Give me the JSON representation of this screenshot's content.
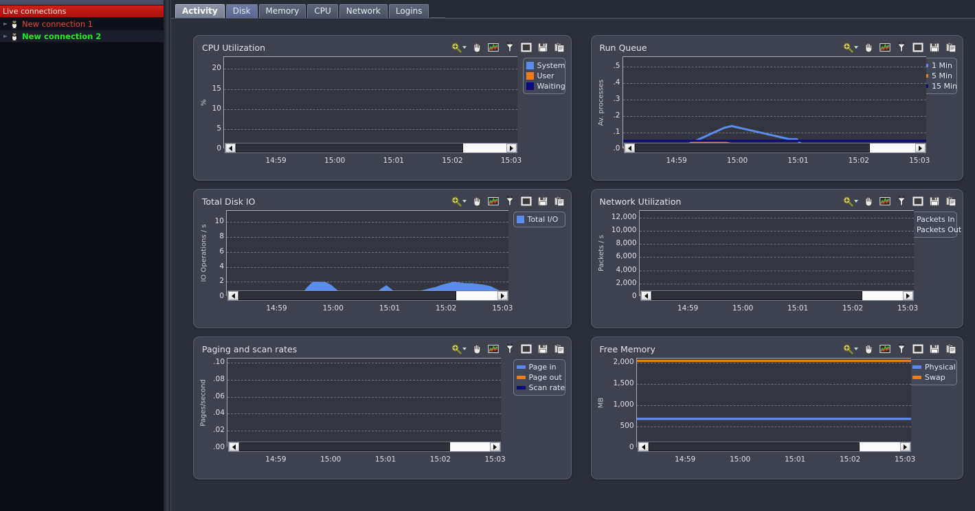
{
  "sidebar": {
    "header": "Live connections",
    "connections": [
      {
        "label": "New connection 1",
        "color": "#e8453c",
        "state": "normal"
      },
      {
        "label": "New connection 2",
        "color": "#22ee22",
        "state": "selected"
      }
    ]
  },
  "tabs": [
    {
      "label": "Activity",
      "active": true
    },
    {
      "label": "Disk",
      "active": false,
      "highlight": true
    },
    {
      "label": "Memory",
      "active": false
    },
    {
      "label": "CPU",
      "active": false
    },
    {
      "label": "Network",
      "active": false
    },
    {
      "label": "Logins",
      "active": false
    }
  ],
  "toolbar": {
    "zoom": "zoom-icon",
    "zoom_caret": "chevron-down-icon",
    "pan": "hand-icon",
    "graph": "line-chart-icon",
    "filter": "funnel-icon",
    "window": "window-icon",
    "save": "floppy-disk-icon",
    "copy": "clipboard-icon"
  },
  "colors": {
    "blue": "#4a82e8",
    "light_blue": "#5b8def",
    "orange": "#f07c18",
    "navy": "#0a0a7a",
    "plot_bg": "#33363f",
    "panel_bg": "#3d424e",
    "accent_red": "#c21a12",
    "accent_green": "#22ee22"
  },
  "chart_data": [
    {
      "id": "cpu-utilization",
      "type": "area",
      "title": "CPU Utilization",
      "ylabel": "%",
      "xlabel": "",
      "ylim": [
        0,
        23
      ],
      "yticks": [
        0,
        5,
        10,
        15,
        20
      ],
      "ytick_labels": [
        "0",
        "5",
        "10",
        "15",
        "20"
      ],
      "xticks": [
        "14:59",
        "15:00",
        "15:01",
        "15:02",
        "15:03"
      ],
      "grid": true,
      "legend_position": "right",
      "legend_style": "box",
      "series": [
        {
          "name": "System",
          "color": "#5b8def",
          "values": [
            0.2,
            0.3,
            0.6,
            1.0,
            1.2,
            0.9,
            0.5,
            0.3,
            0.2,
            0.3,
            0.7,
            1.2,
            0.9,
            0.5,
            0.3,
            0.3,
            0.6,
            1.0,
            1.0,
            1.0,
            1.0,
            1.0,
            1.0,
            1.0,
            1.0,
            1.0,
            1.0,
            1.0,
            1.0,
            1.0,
            1.1,
            1.0,
            1.0,
            1.0,
            1.0,
            1.1,
            1.0,
            0.9,
            0.6,
            0.4,
            0.3,
            0.25,
            0.2
          ]
        },
        {
          "name": "User",
          "color": "#f07c18",
          "values": [
            0,
            0,
            0,
            0,
            0,
            0,
            0,
            0,
            0,
            0,
            0,
            0,
            0,
            0,
            0,
            0,
            0,
            0,
            0,
            0,
            0,
            0,
            0,
            0.3,
            0.8,
            0.9,
            0.6,
            0.3,
            0,
            0,
            0,
            0,
            0,
            0,
            0,
            0,
            0,
            0,
            0,
            0,
            0,
            0,
            0
          ]
        },
        {
          "name": "Waiting",
          "color": "#0a0a7a",
          "values": [
            0,
            0,
            0,
            0,
            0,
            0,
            0,
            0,
            0,
            0,
            0,
            0,
            0,
            0,
            0,
            0,
            0,
            0,
            0,
            0,
            0,
            0,
            0,
            0,
            0,
            0,
            0,
            0,
            0,
            0,
            0,
            0,
            0,
            0,
            0,
            0,
            0,
            0,
            0,
            0,
            0,
            0,
            0
          ]
        }
      ]
    },
    {
      "id": "run-queue",
      "type": "line",
      "title": "Run Queue",
      "ylabel": "Av. processes",
      "xlabel": "",
      "ylim": [
        0,
        0.56
      ],
      "yticks": [
        0.0,
        0.1,
        0.2,
        0.3,
        0.4,
        0.5
      ],
      "ytick_labels": [
        ".0",
        ".1",
        ".2",
        ".3",
        ".4",
        ".5"
      ],
      "xticks": [
        "14:59",
        "15:00",
        "15:01",
        "15:02",
        "15:03"
      ],
      "grid": true,
      "legend_position": "right",
      "legend_style": "line",
      "series": [
        {
          "name": "1 Min",
          "color": "#5b8def",
          "values": [
            0.0,
            0.0,
            0.0,
            0.0,
            0.0,
            0.0,
            0.0,
            0.0,
            0.01,
            0.03,
            0.05,
            0.07,
            0.09,
            0.11,
            0.13,
            0.14,
            0.13,
            0.12,
            0.11,
            0.1,
            0.09,
            0.08,
            0.07,
            0.06,
            0.06,
            0.01,
            0.01,
            0.01,
            0.01,
            0.01,
            0.01,
            0.01,
            0.02,
            0.02,
            0.01,
            0.01,
            0.01,
            0.01,
            0.01,
            0.01,
            0.01,
            0.01,
            0.01
          ]
        },
        {
          "name": "5 Min",
          "color": "#f07c18",
          "values": [
            0.01,
            0.01,
            0.01,
            0.01,
            0.01,
            0.01,
            0.01,
            0.01,
            0.02,
            0.03,
            0.04,
            0.04,
            0.04,
            0.04,
            0.04,
            0.03,
            0.03,
            0.03,
            0.03,
            0.03,
            0.03,
            0.03,
            0.03,
            0.03,
            0.03,
            0.03,
            0.03,
            0.03,
            0.02,
            0.02,
            0.02,
            0.02,
            0.03,
            0.03,
            0.03,
            0.03,
            0.03,
            0.03,
            0.03,
            0.02,
            0.02,
            0.02,
            0.02
          ]
        },
        {
          "name": "15 Min",
          "color": "#0a0a7a",
          "values": [
            0.05,
            0.05,
            0.05,
            0.05,
            0.05,
            0.05,
            0.05,
            0.05,
            0.05,
            0.05,
            0.05,
            0.05,
            0.05,
            0.05,
            0.05,
            0.05,
            0.05,
            0.05,
            0.05,
            0.05,
            0.05,
            0.05,
            0.05,
            0.05,
            0.05,
            0.05,
            0.05,
            0.05,
            0.05,
            0.05,
            0.05,
            0.05,
            0.05,
            0.05,
            0.05,
            0.05,
            0.05,
            0.05,
            0.05,
            0.05,
            0.05,
            0.05,
            0.05
          ]
        }
      ]
    },
    {
      "id": "total-disk-io",
      "type": "area",
      "title": "Total Disk IO",
      "ylabel": "IO Operations / s",
      "xlabel": "",
      "ylim": [
        0,
        11.5
      ],
      "yticks": [
        0,
        2,
        4,
        6,
        8,
        10
      ],
      "ytick_labels": [
        "0",
        "2",
        "4",
        "6",
        "8",
        "10"
      ],
      "xticks": [
        "14:59",
        "15:00",
        "15:01",
        "15:02",
        "15:03"
      ],
      "grid": true,
      "legend_position": "right",
      "legend_style": "box",
      "series": [
        {
          "name": "Total I/O",
          "color": "#5b8def",
          "values": [
            0.1,
            0.1,
            0.2,
            0.25,
            0.3,
            0.25,
            0.1,
            0.1,
            0.2,
            0.35,
            0.3,
            0.15,
            0.1,
            1.2,
            2.0,
            2.0,
            2.0,
            1.6,
            0.9,
            0.25,
            0.4,
            0.8,
            0.5,
            0.2,
            0.3,
            1.0,
            1.55,
            0.9,
            0.2,
            0.3,
            0.5,
            0.7,
            0.9,
            1.1,
            1.3,
            1.6,
            1.8,
            2.0,
            1.9,
            1.8,
            1.8,
            1.7,
            1.6,
            1.4,
            1.0,
            0.6,
            0.4
          ]
        }
      ]
    },
    {
      "id": "network-utilization",
      "type": "line",
      "title": "Network Utilization",
      "ylabel": "Packets / s",
      "xlabel": "",
      "ylim": [
        0,
        13000
      ],
      "yticks": [
        0,
        2000,
        4000,
        6000,
        8000,
        10000,
        12000
      ],
      "ytick_labels": [
        "0",
        "2,000",
        "4,000",
        "6,000",
        "8,000",
        "10,000",
        "12,000"
      ],
      "xticks": [
        "14:59",
        "15:00",
        "15:01",
        "15:02",
        "15:03"
      ],
      "grid": true,
      "legend_position": "right",
      "legend_style": "line",
      "series": [
        {
          "name": "Packets In",
          "color": "#5b8def",
          "constant": 30
        },
        {
          "name": "Packets Out",
          "color": "#f07c18",
          "constant": 10
        }
      ]
    },
    {
      "id": "paging-and-scan-rates",
      "type": "line",
      "title": "Paging and scan rates",
      "ylabel": "Pages/second",
      "xlabel": "",
      "ylim": [
        0,
        0.105
      ],
      "yticks": [
        0.0,
        0.02,
        0.04,
        0.06,
        0.08,
        0.1
      ],
      "ytick_labels": [
        ".00",
        ".02",
        ".04",
        ".06",
        ".08",
        ".10"
      ],
      "xticks": [
        "14:59",
        "15:00",
        "15:01",
        "15:02",
        "15:03"
      ],
      "grid": true,
      "legend_position": "right",
      "legend_style": "line",
      "series": [
        {
          "name": "Page in",
          "color": "#5b8def",
          "constant": 0.0
        },
        {
          "name": "Page out",
          "color": "#f07c18",
          "constant": 0.0
        },
        {
          "name": "Scan rate",
          "color": "#0a0a7a",
          "constant": 0.0
        }
      ]
    },
    {
      "id": "free-memory",
      "type": "line",
      "title": "Free Memory",
      "ylabel": "MB",
      "xlabel": "",
      "ylim": [
        0,
        2100
      ],
      "yticks": [
        0,
        500,
        1000,
        1500,
        2000
      ],
      "ytick_labels": [
        "0",
        "500",
        "1,000",
        "1,500",
        "2,000"
      ],
      "xticks": [
        "14:59",
        "15:00",
        "15:01",
        "15:02",
        "15:03"
      ],
      "grid": true,
      "legend_position": "right",
      "legend_style": "line",
      "series": [
        {
          "name": "Physical",
          "color": "#5b8def",
          "constant": 680
        },
        {
          "name": "Swap",
          "color": "#f07c18",
          "constant": 2045
        }
      ]
    }
  ]
}
